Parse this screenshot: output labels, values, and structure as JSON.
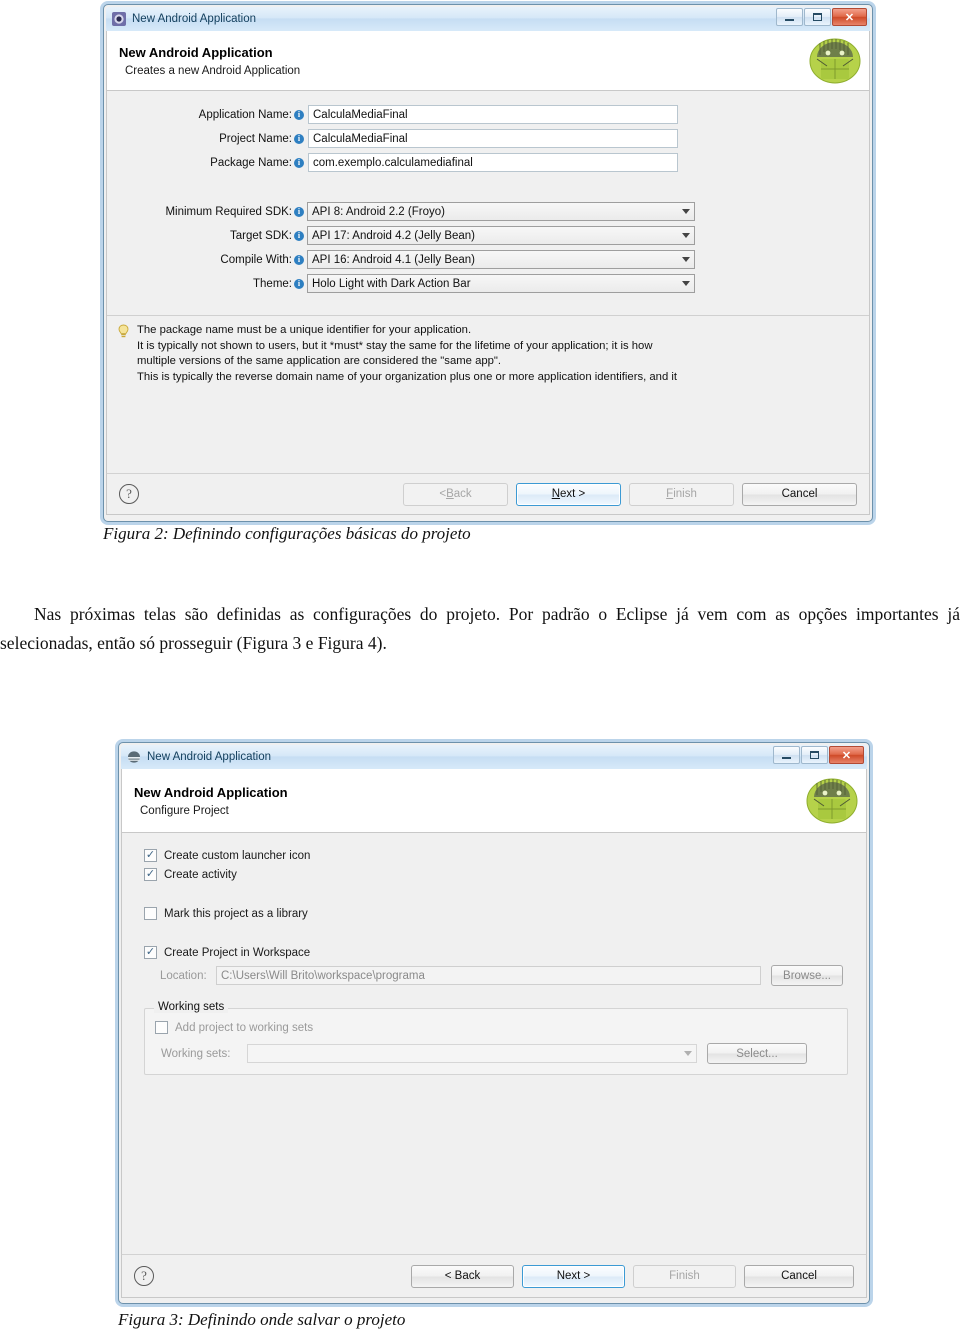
{
  "document": {
    "figure2_caption": "Figura 2: Definindo configurações básicas do projeto",
    "figure3_caption": "Figura 3: Definindo onde salvar o projeto",
    "paragraph": "Nas próximas telas são definidas as configurações do projeto. Por padrão o Eclipse já vem com as opções importantes já selecionadas, então só prosseguir (Figura 3 e Figura 4)."
  },
  "dialog1": {
    "titlebar": {
      "title": "New Android Application",
      "minimize_label": "Minimize",
      "maximize_label": "Maximize",
      "close_label": "✕"
    },
    "header": {
      "title": "New Android Application",
      "subtitle": "Creates a new Android Application"
    },
    "fields": [
      {
        "label": "Application Name:",
        "value": "CalculaMediaFinal"
      },
      {
        "label": "Project Name:",
        "value": "CalculaMediaFinal"
      },
      {
        "label": "Package Name:",
        "value": "com.exemplo.calculamediafinal"
      }
    ],
    "combos": [
      {
        "label": "Minimum Required SDK:",
        "value": "API 8: Android 2.2 (Froyo)"
      },
      {
        "label": "Target SDK:",
        "value": "API 17: Android 4.2 (Jelly Bean)"
      },
      {
        "label": "Compile With:",
        "value": "API 16: Android 4.1 (Jelly Bean)"
      },
      {
        "label": "Theme:",
        "value": "Holo Light with Dark Action Bar"
      }
    ],
    "help": [
      "The package name must be a unique identifier for your application.",
      "It is typically not shown to users, but it *must* stay the same for the lifetime of your application; it is how",
      "multiple versions of the same application are considered the \"same app\".",
      "This is typically the reverse domain name of your organization plus one or more application identifiers, and it"
    ],
    "buttons": {
      "help": "?",
      "back": "< Back",
      "next_prefix": "N",
      "next_rest": "ext >",
      "finish_prefix": "F",
      "finish_rest": "inish",
      "cancel": "Cancel"
    }
  },
  "dialog2": {
    "titlebar": {
      "title": "New Android Application",
      "close_label": "✕"
    },
    "header": {
      "title": "New Android Application",
      "subtitle": "Configure Project"
    },
    "checkboxes": [
      {
        "label": "Create custom launcher icon",
        "checked": true
      },
      {
        "label": "Create activity",
        "checked": true
      },
      {
        "label": "Mark this project as a library",
        "checked": false
      },
      {
        "label": "Create Project in Workspace",
        "checked": true
      }
    ],
    "location": {
      "label": "Location:",
      "value": "C:\\Users\\Will Brito\\workspace\\programa",
      "browse_label": "Browse..."
    },
    "working_sets": {
      "group_title": "Working sets",
      "add_checkbox_label": "Add project to working sets",
      "add_checked": false,
      "field_label": "Working sets:",
      "field_value": "",
      "select_label": "Select..."
    },
    "buttons": {
      "help": "?",
      "back": "< Back",
      "next": "Next >",
      "finish": "Finish",
      "cancel": "Cancel"
    }
  },
  "colors": {
    "accent_blue": "#3c9ad4",
    "title_blue": "#c6ddf3",
    "close_red": "#cf4a28",
    "android_green": "#a4c639",
    "dialog_bg": "#f0f0f0"
  }
}
